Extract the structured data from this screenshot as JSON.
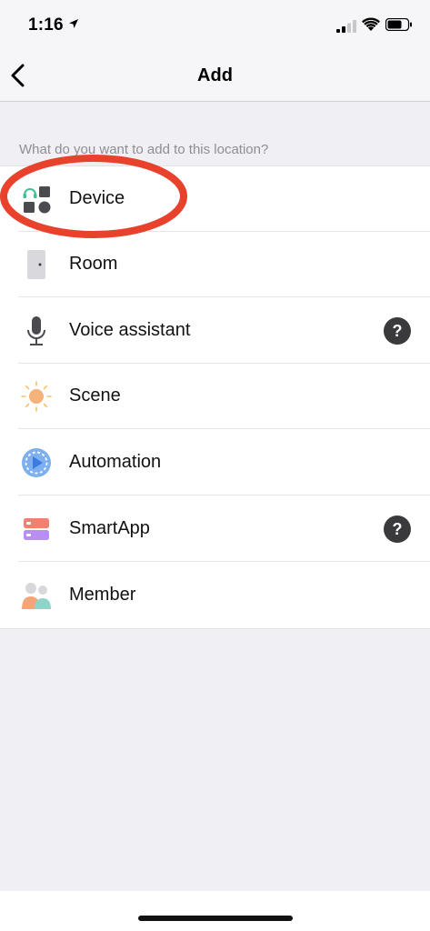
{
  "status_bar": {
    "time": "1:16",
    "icons": [
      "location-arrow-icon",
      "cellular-signal-icon",
      "wifi-icon",
      "battery-icon"
    ]
  },
  "nav": {
    "title": "Add",
    "back_icon": "chevron-left-icon"
  },
  "section_header": "What do you want to add to this location?",
  "items": [
    {
      "label": "Device",
      "icon": "device-icon",
      "help": false
    },
    {
      "label": "Room",
      "icon": "room-door-icon",
      "help": false
    },
    {
      "label": "Voice assistant",
      "icon": "microphone-icon",
      "help": true
    },
    {
      "label": "Scene",
      "icon": "sun-icon",
      "help": false
    },
    {
      "label": "Automation",
      "icon": "automation-play-icon",
      "help": false
    },
    {
      "label": "SmartApp",
      "icon": "smartapp-icon",
      "help": true
    },
    {
      "label": "Member",
      "icon": "members-icon",
      "help": false
    }
  ],
  "colors": {
    "highlight": "#e8412c",
    "background": "#efeff4",
    "help_icon": "#3a3a3c"
  }
}
